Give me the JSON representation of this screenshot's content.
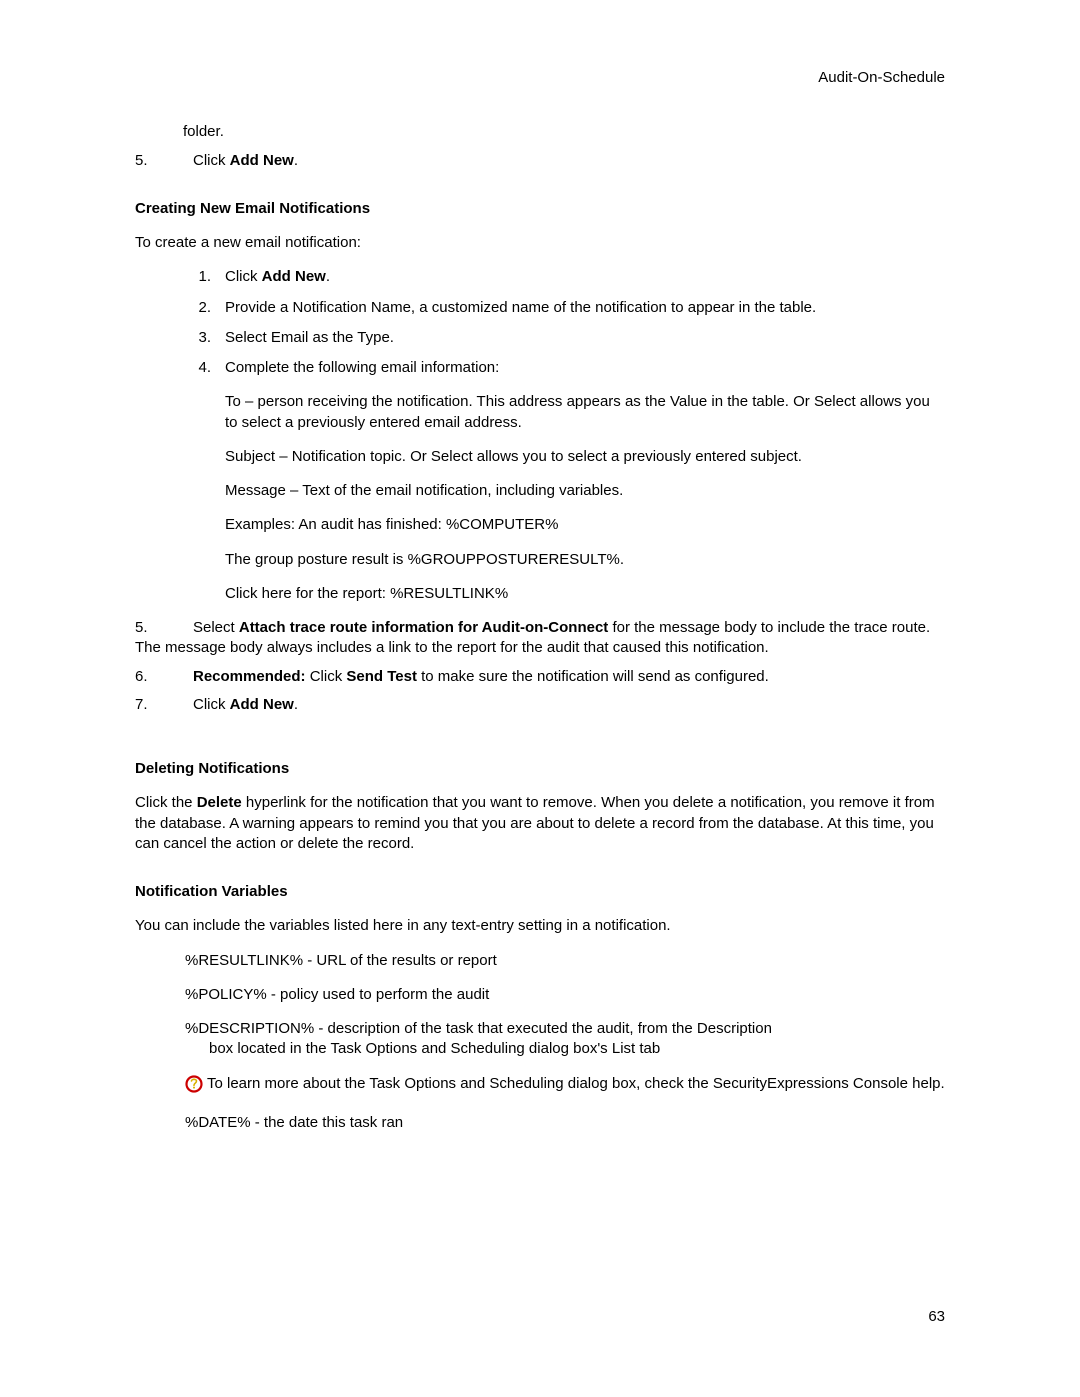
{
  "header": {
    "title": "Audit-On-Schedule"
  },
  "top": {
    "folder_line": "folder.",
    "item5_num": "5.",
    "item5_prefix": "Click ",
    "item5_cmd": "Add New",
    "item5_suffix": "."
  },
  "create": {
    "heading": "Creating New Email Notifications",
    "intro": "To create a new email notification:",
    "i1_num": "1.",
    "i1_prefix": "Click ",
    "i1_cmd": "Add New",
    "i1_suffix": ".",
    "i2_num": "2.",
    "i2_text": "Provide a Notification Name, a customized name of the notification to appear in the table.",
    "i3_num": "3.",
    "i3_text": "Select Email as the Type.",
    "i4_num": "4.",
    "i4_text": "Complete the following email information:",
    "d_to": "To – person receiving the notification. This address appears as the Value in the table. Or Select allows you to select a previously entered email address.",
    "d_subject": "Subject – Notification topic. Or Select allows you to select a previously entered subject.",
    "d_message": "Message – Text of the email notification, including variables.",
    "d_ex": "Examples: An audit has finished: %COMPUTER%",
    "d_group": "The group posture result is %GROUPPOSTURERESULT%.",
    "d_link": "Click here for the report: %RESULTLINK%",
    "i5_num": "5.",
    "i5_prefix": "Select ",
    "i5_cmd": "Attach trace route information for Audit-on-Connect",
    "i5_rest": " for the message body to include the trace route. The message body always includes a link to the report for the audit that caused this notification.",
    "i6_num": "6.",
    "i6_b1": "Recommended:",
    "i6_m1": " Click ",
    "i6_b2": "Send Test",
    "i6_m2": " to make sure the notification will send as configured.",
    "i7_num": "7.",
    "i7_prefix": "Click ",
    "i7_cmd": "Add New",
    "i7_suffix": "."
  },
  "delete": {
    "heading": "Deleting Notifications",
    "p_pre": "Click the ",
    "p_cmd": "Delete",
    "p_post": " hyperlink for the notification that you want to remove. When you delete a notification, you remove it from the database. A warning appears to remind you that you are about to delete a record from the database. At this time, you can cancel the action or delete the record."
  },
  "vars": {
    "heading": "Notification Variables",
    "intro": "You can include the variables listed here in any text-entry setting in a notification.",
    "v1": "%RESULTLINK% - URL of the results or report",
    "v2": "%POLICY% - policy used to perform the audit",
    "v3a": "%DESCRIPTION% - description of the task that executed the audit, from the Description",
    "v3b": "box located in the Task Options and Scheduling dialog box's List tab",
    "tip": "To learn more about the Task Options and Scheduling dialog box, check the SecurityExpressions Console help.",
    "v4": "%DATE% - the date this task ran"
  },
  "footer": {
    "page_num": "63"
  }
}
